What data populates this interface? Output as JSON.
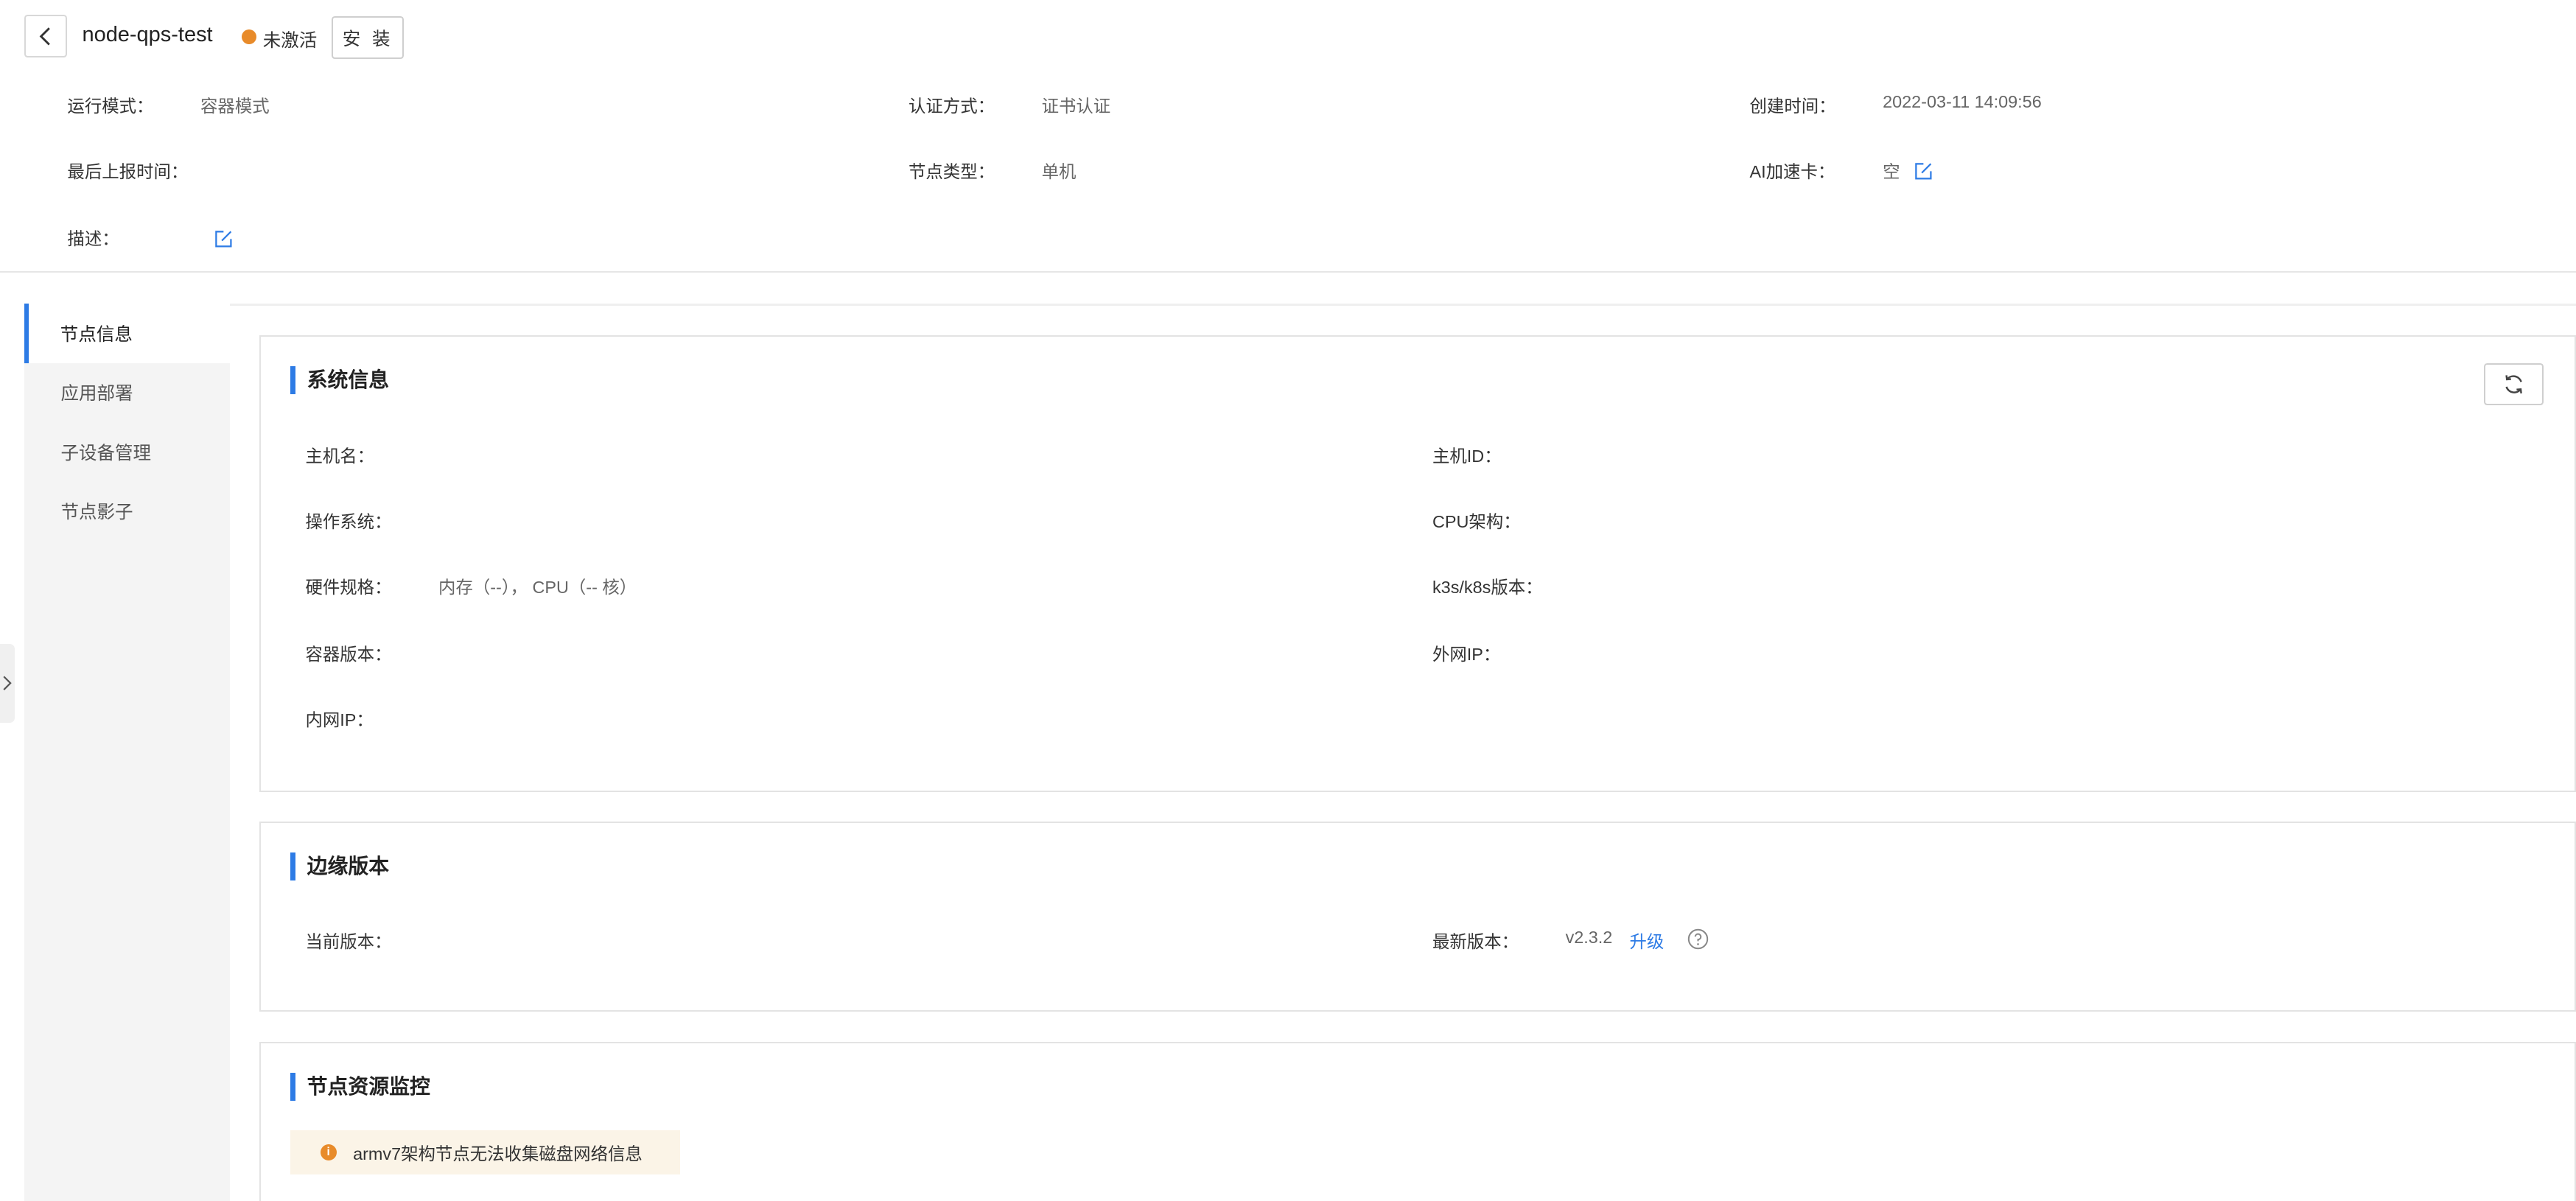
{
  "header": {
    "title": "node-qps-test",
    "status": {
      "text": "未激活",
      "color": "#e88b2a"
    },
    "install_label": "安 装"
  },
  "info": {
    "run_mode_label": "运行模式：",
    "run_mode_value": "容器模式",
    "auth_label": "认证方式：",
    "auth_value": "证书认证",
    "created_label": "创建时间：",
    "created_value": "2022-03-11 14:09:56",
    "last_report_label": "最后上报时间：",
    "last_report_value": "",
    "node_type_label": "节点类型：",
    "node_type_value": "单机",
    "ai_card_label": "AI加速卡：",
    "ai_card_value": "空",
    "desc_label": "描述：",
    "desc_value": ""
  },
  "nav": {
    "items": [
      {
        "label": "节点信息",
        "active": true
      },
      {
        "label": "应用部署",
        "active": false
      },
      {
        "label": "子设备管理",
        "active": false
      },
      {
        "label": "节点影子",
        "active": false
      }
    ]
  },
  "system": {
    "title": "系统信息",
    "hostname_label": "主机名：",
    "hostid_label": "主机ID：",
    "os_label": "操作系统：",
    "cpu_arch_label": "CPU架构：",
    "hw_label": "硬件规格：",
    "hw_value": "内存（--），  CPU（-- 核）",
    "k8s_label": "k3s/k8s版本：",
    "container_label": "容器版本：",
    "public_ip_label": "外网IP：",
    "private_ip_label": "内网IP："
  },
  "edge": {
    "title": "边缘版本",
    "current_label": "当前版本：",
    "latest_label": "最新版本：",
    "latest_value": "v2.3.2",
    "upgrade_label": "升级"
  },
  "monitor": {
    "title": "节点资源监控",
    "warning": "armv7架构节点无法收集磁盘网络信息"
  },
  "colors": {
    "accent": "#2d7be5",
    "warning": "#e88b2a"
  }
}
